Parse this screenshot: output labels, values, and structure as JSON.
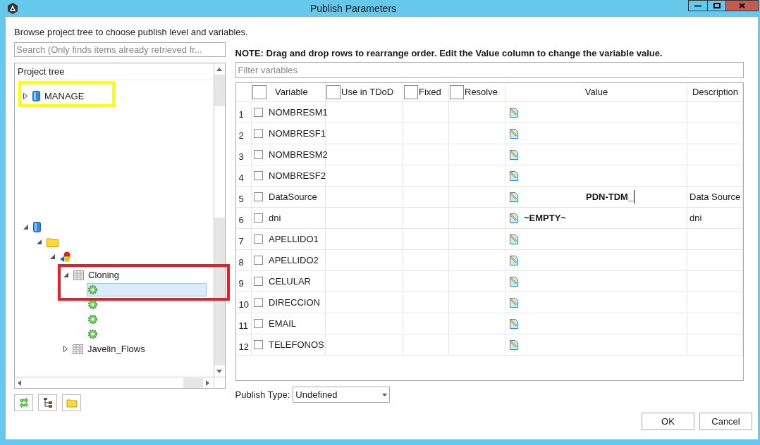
{
  "window": {
    "title": "Publish Parameters"
  },
  "instructions": "Browse project tree to choose publish level and variables.",
  "search": {
    "placeholder": "Search (Only finds items already retrieved fr..."
  },
  "project_tree": {
    "header": "Project tree",
    "items": [
      {
        "kind": "database",
        "label": "MANAGE",
        "expanded": false,
        "selected": false,
        "highlight": {
          "color": "#ffff00"
        }
      }
    ],
    "lower_items": [
      {
        "kind": "database",
        "expanded": true,
        "selected": false,
        "children": [
          {
            "kind": "folder",
            "expanded": true,
            "selected": false,
            "children": [
              {
                "kind": "project",
                "expanded": true,
                "selected": false,
                "children": [
                  {
                    "kind": "table",
                    "label": "Cloning",
                    "expanded": true,
                    "selected": false,
                    "highlight": {
                      "color": "#ed1c24"
                    },
                    "children": [
                      {
                        "kind": "gear",
                        "selected": true
                      },
                      {
                        "kind": "gear",
                        "selected": false
                      },
                      {
                        "kind": "gear",
                        "selected": false
                      },
                      {
                        "kind": "gear",
                        "selected": false
                      }
                    ]
                  },
                  {
                    "kind": "table",
                    "label": "Javelin_Flows",
                    "expanded": false,
                    "selected": false
                  }
                ]
              }
            ]
          }
        ]
      }
    ]
  },
  "note": "NOTE: Drag and drop rows to rearrange order. Edit the Value column to change the variable value.",
  "filter": {
    "placeholder": "Filter variables"
  },
  "table": {
    "columns": [
      {
        "label": "Variable",
        "checked": false
      },
      {
        "label": "Use in TDoD",
        "checked": false
      },
      {
        "label": "Fixed",
        "checked": false
      },
      {
        "label": "Resolve",
        "checked": false
      },
      {
        "label": "Value"
      },
      {
        "label": "Description"
      }
    ],
    "rows": [
      {
        "number": "1",
        "variable": "NOMBRESM1",
        "checked": false
      },
      {
        "number": "2",
        "variable": "NOMBRESF1",
        "checked": false
      },
      {
        "number": "3",
        "variable": "NOMBRESM2",
        "checked": false
      },
      {
        "number": "4",
        "variable": "NOMBRESF2",
        "checked": false
      },
      {
        "number": "5",
        "variable": "DataSource",
        "checked": false,
        "value": "PDN-TDM_",
        "editing": true,
        "description": "Data Source"
      },
      {
        "number": "6",
        "variable": "dni",
        "checked": false,
        "value": "~EMPTY~",
        "editing": false,
        "description": "dni"
      },
      {
        "number": "7",
        "variable": "APELLIDO1",
        "checked": false
      },
      {
        "number": "8",
        "variable": "APELLIDO2",
        "checked": false
      },
      {
        "number": "9",
        "variable": "CELULAR",
        "checked": false
      },
      {
        "number": "10",
        "variable": "DIRECCION",
        "checked": false
      },
      {
        "number": "11",
        "variable": "EMAIL",
        "checked": false
      },
      {
        "number": "12",
        "variable": "TELEFONOS",
        "checked": false
      }
    ]
  },
  "publish_type": {
    "label": "Publish Type:",
    "value": "Undefined"
  },
  "buttons": [
    "OK",
    "Cancel"
  ]
}
